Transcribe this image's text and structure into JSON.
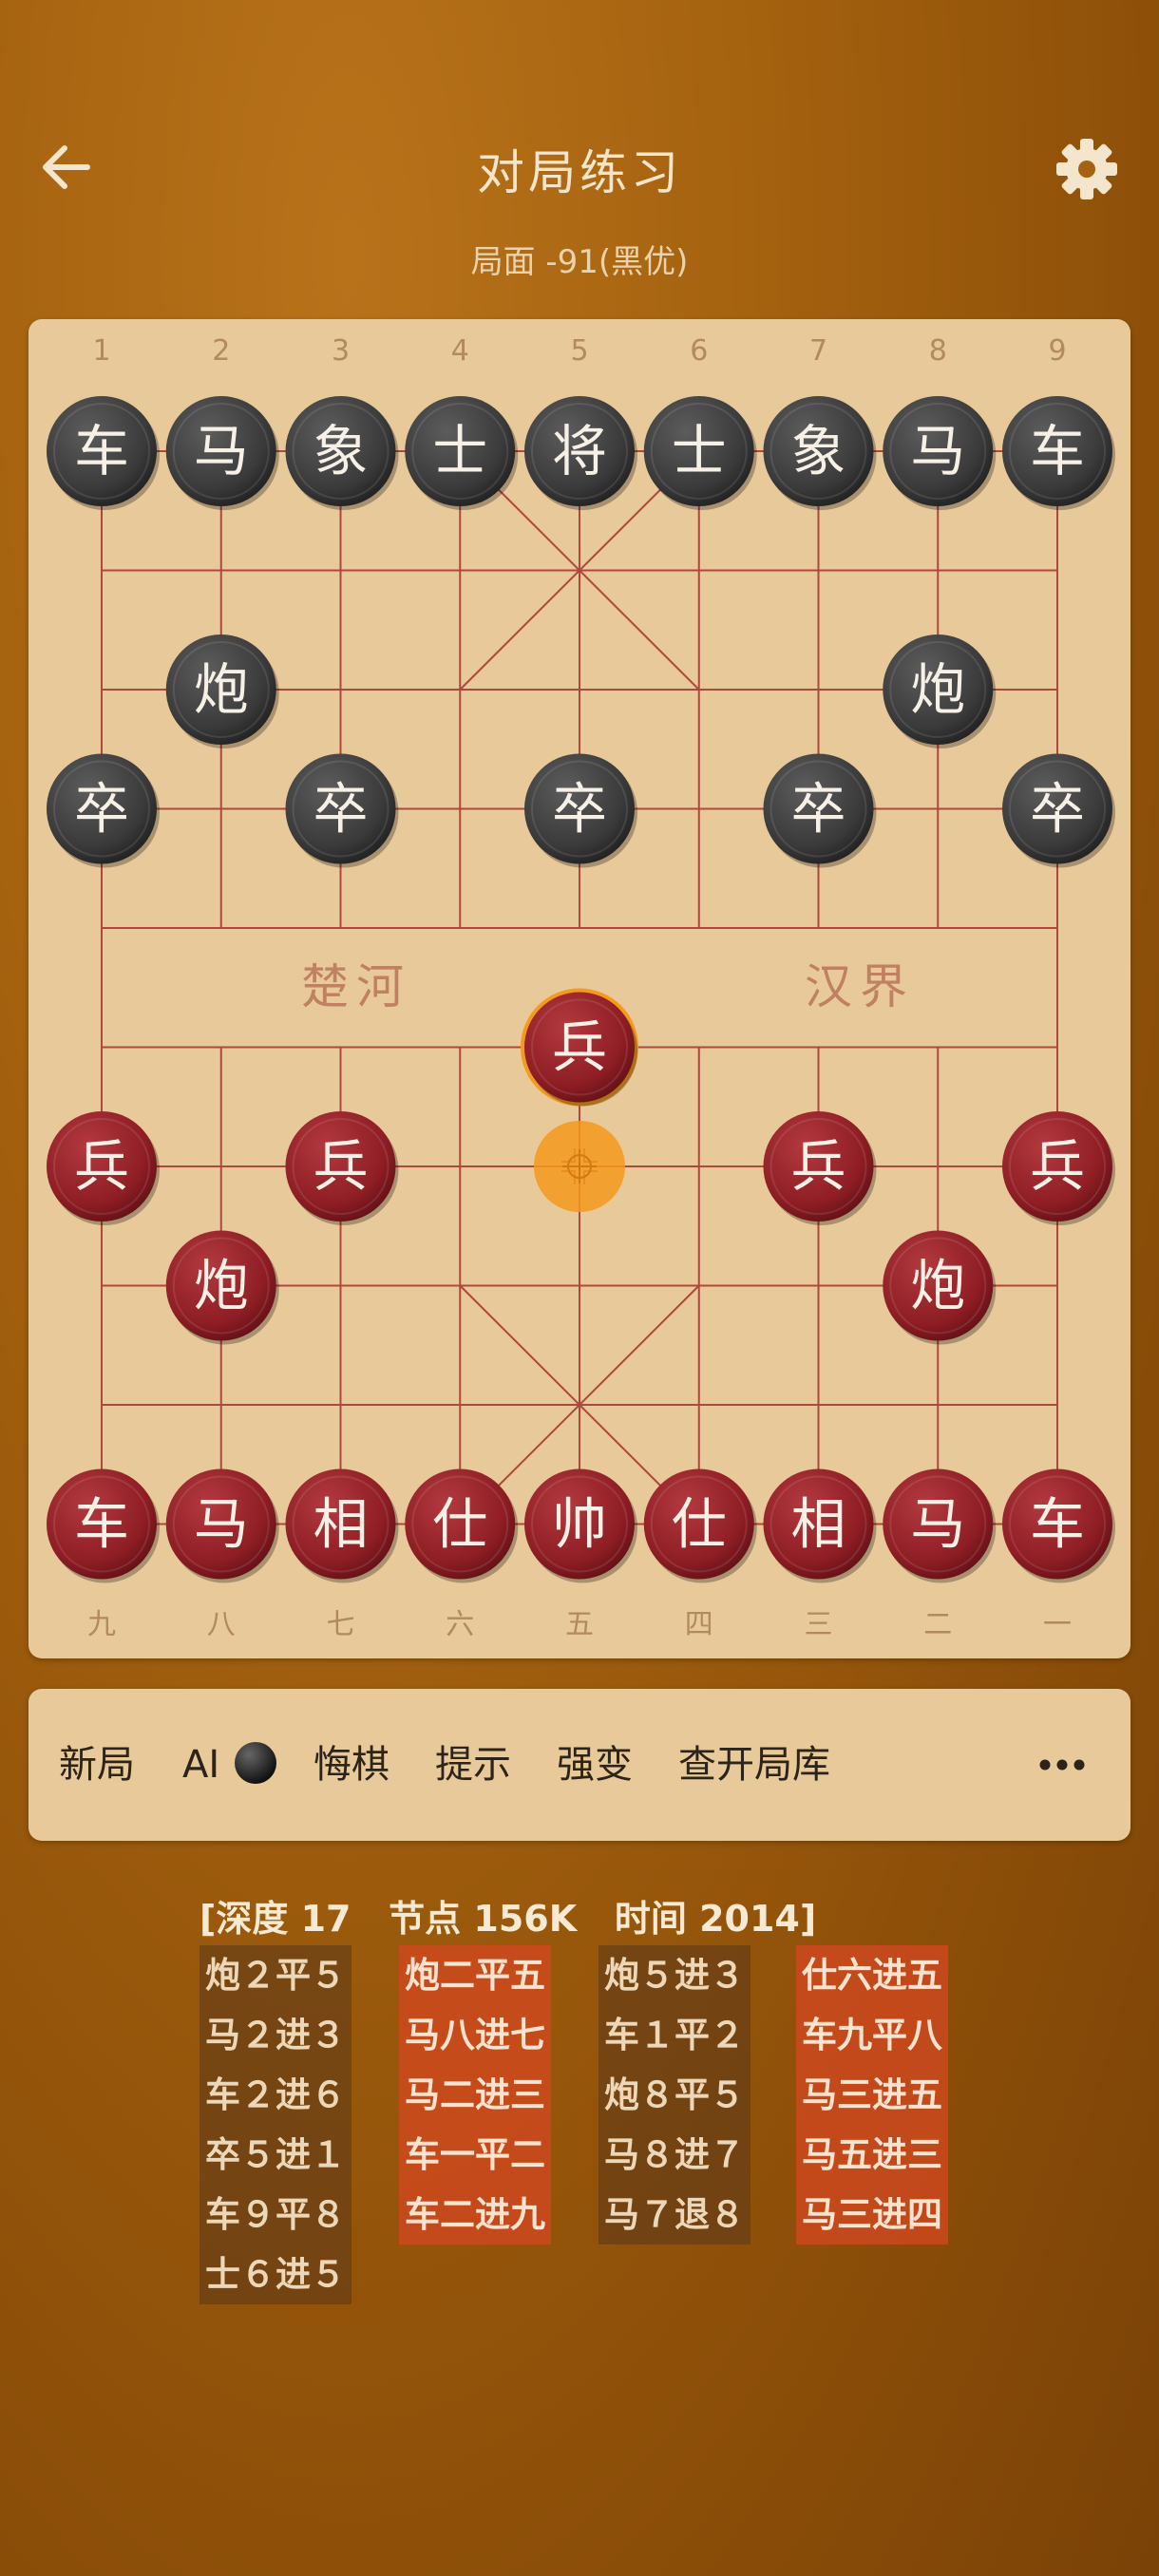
{
  "header": {
    "back_icon": "arrow-left-icon",
    "title": "对局练习",
    "settings_icon": "gear-icon",
    "evaluation": "局面 -91(黑优)"
  },
  "board": {
    "files_top": [
      "1",
      "2",
      "3",
      "4",
      "5",
      "6",
      "7",
      "8",
      "9"
    ],
    "files_bottom": [
      "九",
      "八",
      "七",
      "六",
      "五",
      "四",
      "三",
      "二",
      "一"
    ],
    "river_left": "楚河",
    "river_right": "汉界",
    "colors": {
      "board": "#e8c99a",
      "lines": "#b0473c",
      "black_piece": "#3a3a3a",
      "red_piece": "#8e1d24",
      "highlight": "#f39a1f"
    },
    "pieces": [
      {
        "side": "black",
        "label": "车",
        "file": 1,
        "rank": 1,
        "name": "black-chariot"
      },
      {
        "side": "black",
        "label": "马",
        "file": 2,
        "rank": 1,
        "name": "black-horse"
      },
      {
        "side": "black",
        "label": "象",
        "file": 3,
        "rank": 1,
        "name": "black-elephant"
      },
      {
        "side": "black",
        "label": "士",
        "file": 4,
        "rank": 1,
        "name": "black-advisor"
      },
      {
        "side": "black",
        "label": "将",
        "file": 5,
        "rank": 1,
        "name": "black-general"
      },
      {
        "side": "black",
        "label": "士",
        "file": 6,
        "rank": 1,
        "name": "black-advisor"
      },
      {
        "side": "black",
        "label": "象",
        "file": 7,
        "rank": 1,
        "name": "black-elephant"
      },
      {
        "side": "black",
        "label": "马",
        "file": 8,
        "rank": 1,
        "name": "black-horse"
      },
      {
        "side": "black",
        "label": "车",
        "file": 9,
        "rank": 1,
        "name": "black-chariot"
      },
      {
        "side": "black",
        "label": "炮",
        "file": 2,
        "rank": 3,
        "name": "black-cannon"
      },
      {
        "side": "black",
        "label": "炮",
        "file": 8,
        "rank": 3,
        "name": "black-cannon"
      },
      {
        "side": "black",
        "label": "卒",
        "file": 1,
        "rank": 4,
        "name": "black-soldier"
      },
      {
        "side": "black",
        "label": "卒",
        "file": 3,
        "rank": 4,
        "name": "black-soldier"
      },
      {
        "side": "black",
        "label": "卒",
        "file": 5,
        "rank": 4,
        "name": "black-soldier"
      },
      {
        "side": "black",
        "label": "卒",
        "file": 7,
        "rank": 4,
        "name": "black-soldier"
      },
      {
        "side": "black",
        "label": "卒",
        "file": 9,
        "rank": 4,
        "name": "black-soldier"
      },
      {
        "side": "red",
        "label": "兵",
        "file": 5,
        "rank": 6,
        "name": "red-soldier-selected",
        "highlight": true
      },
      {
        "side": "red",
        "label": "兵",
        "file": 1,
        "rank": 7,
        "name": "red-soldier"
      },
      {
        "side": "red",
        "label": "兵",
        "file": 3,
        "rank": 7,
        "name": "red-soldier"
      },
      {
        "side": "red",
        "label": "兵",
        "file": 7,
        "rank": 7,
        "name": "red-soldier"
      },
      {
        "side": "red",
        "label": "兵",
        "file": 9,
        "rank": 7,
        "name": "red-soldier"
      },
      {
        "side": "red",
        "label": "炮",
        "file": 2,
        "rank": 8,
        "name": "red-cannon"
      },
      {
        "side": "red",
        "label": "炮",
        "file": 8,
        "rank": 8,
        "name": "red-cannon"
      },
      {
        "side": "red",
        "label": "车",
        "file": 1,
        "rank": 10,
        "name": "red-chariot"
      },
      {
        "side": "red",
        "label": "马",
        "file": 2,
        "rank": 10,
        "name": "red-horse"
      },
      {
        "side": "red",
        "label": "相",
        "file": 3,
        "rank": 10,
        "name": "red-elephant"
      },
      {
        "side": "red",
        "label": "仕",
        "file": 4,
        "rank": 10,
        "name": "red-advisor"
      },
      {
        "side": "red",
        "label": "帅",
        "file": 5,
        "rank": 10,
        "name": "red-general"
      },
      {
        "side": "red",
        "label": "仕",
        "file": 6,
        "rank": 10,
        "name": "red-advisor"
      },
      {
        "side": "red",
        "label": "相",
        "file": 7,
        "rank": 10,
        "name": "red-elephant"
      },
      {
        "side": "red",
        "label": "马",
        "file": 8,
        "rank": 10,
        "name": "red-horse"
      },
      {
        "side": "red",
        "label": "车",
        "file": 9,
        "rank": 10,
        "name": "red-chariot"
      }
    ],
    "last_move_from": {
      "file": 5,
      "rank": 7,
      "name": "last-move-origin-marker"
    }
  },
  "toolbar": {
    "new_game": "新局",
    "ai_label": "AI",
    "ai_icon": "black-disc-icon",
    "undo": "悔棋",
    "hint": "提示",
    "strong_variation": "强变",
    "opening_book": "查开局库",
    "more_icon": "more-dots-icon"
  },
  "engine": {
    "header": "[深度 17   节点 156K   时间 2014]",
    "columns": [
      {
        "style": "dark",
        "moves": [
          "炮２平５",
          "马２进３",
          "车２进６",
          "卒５进１",
          "车９平８",
          "士６进５"
        ]
      },
      {
        "style": "red",
        "moves": [
          "炮二平五",
          "马八进七",
          "马二进三",
          "车一平二",
          "车二进九"
        ]
      },
      {
        "style": "dark",
        "moves": [
          "炮５进３",
          "车１平２",
          "炮８平５",
          "马８进７",
          "马７退８"
        ]
      },
      {
        "style": "red",
        "moves": [
          "仕六进五",
          "车九平八",
          "马三进五",
          "马五进三",
          "马三进四"
        ]
      }
    ]
  }
}
